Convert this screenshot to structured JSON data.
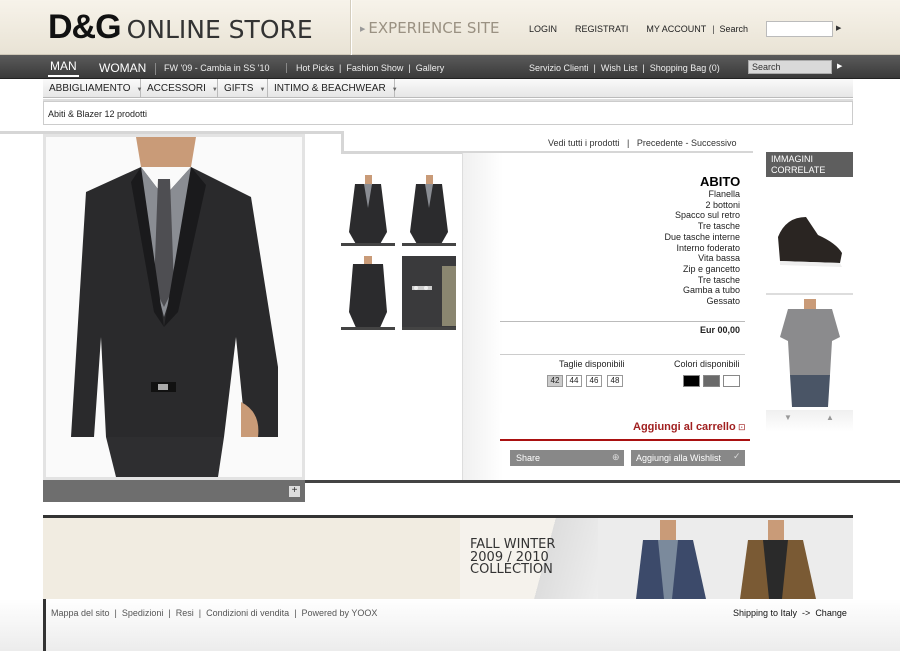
{
  "header": {
    "brand": "D&G",
    "store": "ONLINE STORE",
    "experience": "EXPERIENCE SITE",
    "login": "LOGIN",
    "register": "REGISTRATI",
    "account": "MY ACCOUNT",
    "search_label": "Search",
    "search_value": ""
  },
  "nav": {
    "man": "MAN",
    "woman": "WOMAN",
    "season": "FW '09 - Cambia in SS '10",
    "links": [
      "Hot Picks",
      "Fashion Show",
      "Gallery"
    ],
    "service": [
      "Servizio Clienti",
      "Wish List",
      "Shopping Bag (0)"
    ],
    "search_placeholder": "Search"
  },
  "categories": [
    {
      "label": "ABBIGLIAMENTO"
    },
    {
      "label": "ACCESSORI"
    },
    {
      "label": "GIFTS"
    },
    {
      "label": "INTIMO & BEACHWEAR"
    }
  ],
  "breadcrumb": "Abiti & Blazer  12 prodotti",
  "product_nav": {
    "all": "Vedi tutti i prodotti",
    "prev": "Precedente",
    "next": "Successivo"
  },
  "product": {
    "name": "ABITO",
    "features": [
      "Flanella",
      "2 bottoni",
      "Spacco sul retro",
      "Tre tasche",
      "Due tasche interne",
      "Interno foderato",
      "Vita bassa",
      "Zip e gancetto",
      "Tre tasche",
      "Gamba a tubo",
      "Gessato"
    ],
    "price": "Eur 00,00",
    "sizes_label": "Taglie disponibili",
    "colors_label": "Colori disponibili",
    "sizes": [
      "42",
      "44",
      "46",
      "48"
    ],
    "selected_size": "42",
    "colors": [
      "#000000",
      "#6a6a6a",
      "#ffffff"
    ],
    "add_to_cart": "Aggiungi al carrello",
    "share": "Share",
    "wishlist": "Aggiungi alla  Wishlist"
  },
  "related": {
    "title": "IMMAGINI CORRELATE"
  },
  "banner": {
    "line1": "FALL WINTER",
    "line2": "2009 / 2010",
    "line3": "COLLECTION"
  },
  "footer": {
    "links": [
      "Mappa del sito",
      "Spedizioni",
      "Resi",
      "Condizioni di vendita",
      "Powered by YOOX"
    ],
    "shipping": "Shipping to Italy",
    "change": "Change"
  }
}
